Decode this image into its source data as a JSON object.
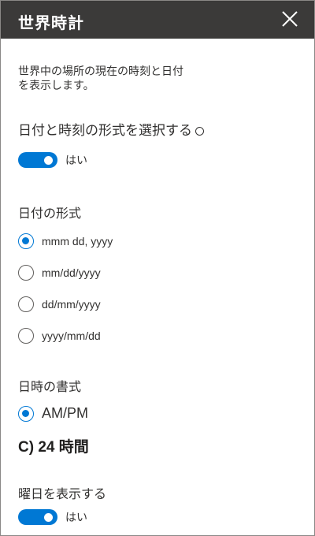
{
  "header": {
    "title": "世界時計",
    "close_icon": "close-icon"
  },
  "description": {
    "line1": "世界中の場所の現在の時刻と日付",
    "line2": "を表示します。"
  },
  "choose_format": {
    "label": "日付と時刻の形式を選択する",
    "toggle_label": "はい",
    "toggle_on": true
  },
  "date_format": {
    "label": "日付の形式",
    "options": [
      "mmm dd, yyyy",
      "mm/dd/yyyy",
      "dd/mm/yyyy",
      "yyyy/mm/dd"
    ],
    "selected": "mmm dd, yyyy"
  },
  "time_format": {
    "label": "日時の書式",
    "option_ampm": "AM/PM",
    "option_24": "C) 24 時間",
    "selected": "AM/PM"
  },
  "show_weekday": {
    "label": "曜日を表示する",
    "toggle_label": "はい",
    "toggle_on": true
  },
  "colors": {
    "accent": "#0078d4",
    "header_bg": "#3b3a39"
  }
}
